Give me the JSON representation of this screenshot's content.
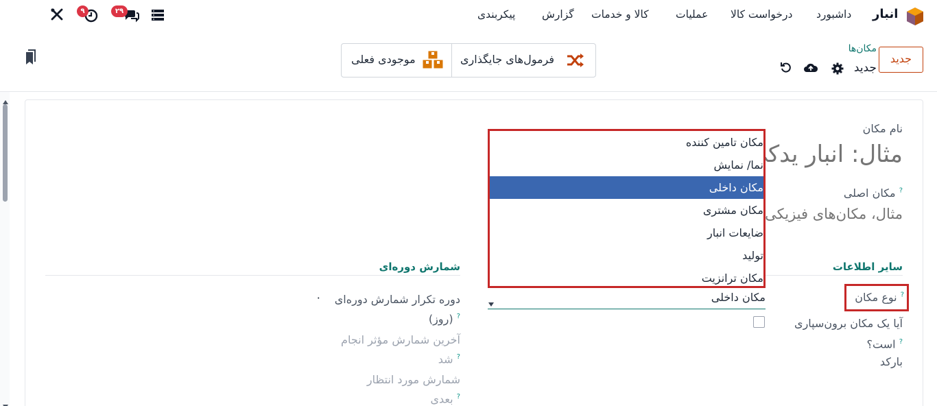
{
  "navbar": {
    "brand": "انبار",
    "menu": [
      "داشبورد",
      "درخواست کالا",
      "عملیات",
      "کالا و خدمات",
      "گزارش",
      "پیکربندی"
    ],
    "messages_badge": "۲۹",
    "activity_badge": "۹"
  },
  "control_panel": {
    "new_button": "جدید",
    "breadcrumb": "مکان‌ها",
    "record_name": "جدید",
    "smart_buttons": {
      "putaway": "فرمول‌های جایگذاری",
      "stock": "موجودی فعلی"
    }
  },
  "form": {
    "name_label": "نام مکان",
    "name_placeholder": "مثال: انبار یدکی",
    "parent_label": "مکان اصلی",
    "parent_placeholder": "مثال، مکان‌های فیزیکی",
    "help_mark": "?",
    "section_other": "سایر اطلاعات",
    "location_type_label": "نوع مکان",
    "location_type_value": "مکان داخلی",
    "location_type_options": [
      "مکان تامین کننده",
      "نما/ نمایش",
      "مکان داخلی",
      "مکان مشتری",
      "ضایعات انبار",
      "تولید",
      "مکان ترانزیت"
    ],
    "selected_index": 2,
    "subcontract_label_1": "آیا یک مکان برون‌سپاری",
    "subcontract_label_2": "است؟",
    "barcode_label": "بارکد",
    "section_cyclic": "شمارش دوره‌ای",
    "cyclic_freq_label_1": "دوره تکرار شمارش دوره‌ای",
    "cyclic_freq_label_2": "(روز)",
    "cyclic_freq_value": "۰",
    "last_count_label_1": "آخرین شمارش مؤثر انجام",
    "last_count_label_2": "شد",
    "next_count_label_1": "شمارش مورد انتظار",
    "next_count_label_2": "بعدی"
  },
  "colors": {
    "accent": "#c2410c",
    "teal": "#0f766e",
    "highlight": "#c62828",
    "selected_option": "#3a67b0"
  }
}
